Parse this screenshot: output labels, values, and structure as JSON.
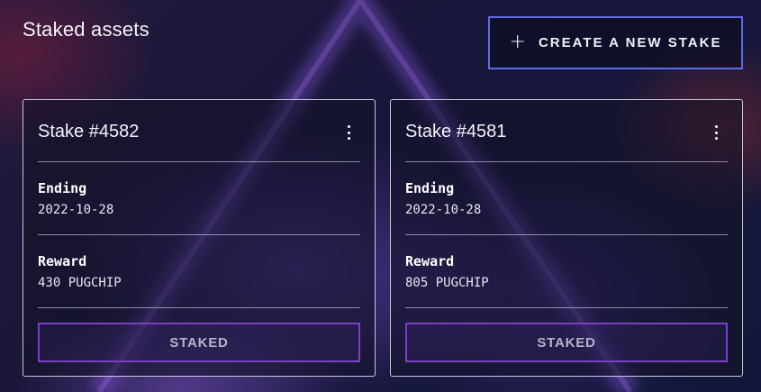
{
  "page": {
    "title": "Staked assets"
  },
  "actions": {
    "create_label": "CREATE A NEW STAKE",
    "create_icon": "plus-icon"
  },
  "stakes": [
    {
      "title": "Stake #4582",
      "ending_label": "Ending",
      "ending_value": "2022-10-28",
      "reward_label": "Reward",
      "reward_value": "430 PUGCHIP",
      "status_label": "STAKED",
      "menu_icon": "more-vertical-icon"
    },
    {
      "title": "Stake #4581",
      "ending_label": "Ending",
      "ending_value": "2022-10-28",
      "reward_label": "Reward",
      "reward_value": "805 PUGCHIP",
      "status_label": "STAKED",
      "menu_icon": "more-vertical-icon"
    }
  ],
  "colors": {
    "accent_border": "#5f6de0",
    "staked_border": "#7b3fc2",
    "background": "#14142c"
  }
}
